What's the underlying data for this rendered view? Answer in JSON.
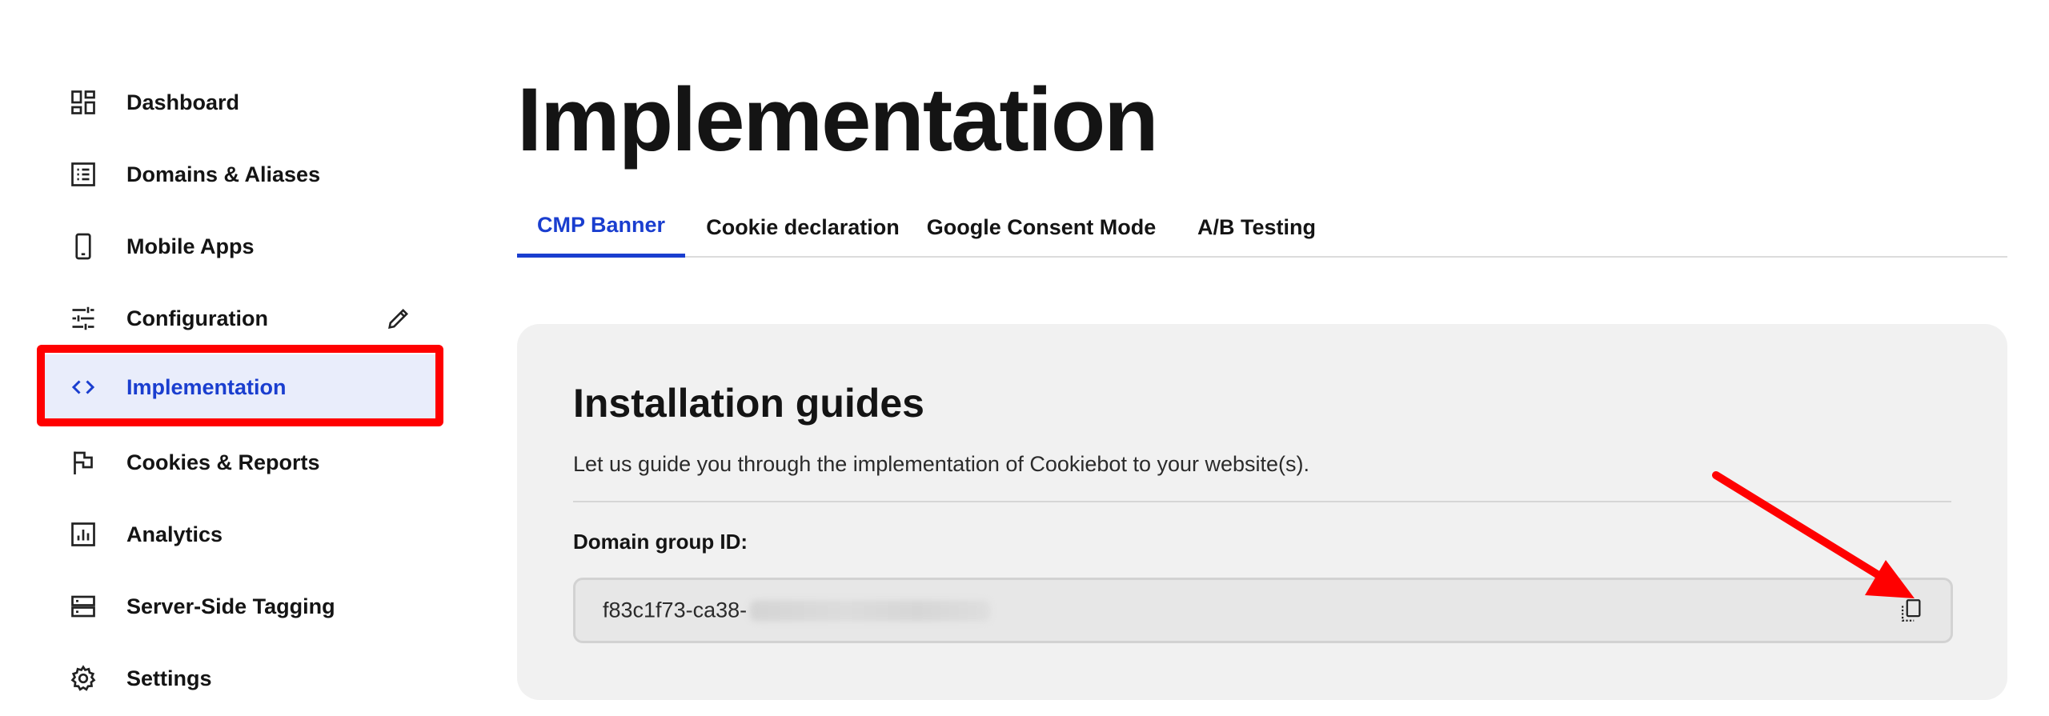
{
  "sidebar": {
    "items": [
      {
        "label": "Dashboard",
        "icon": "dashboard-icon"
      },
      {
        "label": "Domains & Aliases",
        "icon": "list-icon"
      },
      {
        "label": "Mobile Apps",
        "icon": "mobile-icon"
      },
      {
        "label": "Configuration",
        "icon": "sliders-icon",
        "action_icon": "pencil-icon"
      },
      {
        "label": "Implementation",
        "icon": "code-icon",
        "active": true
      },
      {
        "label": "Cookies & Reports",
        "icon": "flag-icon"
      },
      {
        "label": "Analytics",
        "icon": "analytics-icon"
      },
      {
        "label": "Server-Side Tagging",
        "icon": "server-icon"
      },
      {
        "label": "Settings",
        "icon": "gear-icon"
      }
    ]
  },
  "main": {
    "title": "Implementation",
    "tabs": [
      {
        "label": "CMP Banner",
        "active": true
      },
      {
        "label": "Cookie declaration"
      },
      {
        "label": "Google Consent Mode"
      },
      {
        "label": "A/B Testing"
      }
    ],
    "card": {
      "title": "Installation guides",
      "description": "Let us guide you through the implementation of Cookiebot to your website(s).",
      "field_label": "Domain group ID:",
      "field_value_visible": "f83c1f73-ca38-",
      "copy_icon": "copy-icon"
    }
  },
  "annotations": {
    "highlight_color": "#ff0000",
    "arrow_color": "#ff0000"
  },
  "colors": {
    "accent": "#1a3ecf",
    "active_bg": "#e9edfb",
    "card_bg": "#f1f1f1"
  }
}
